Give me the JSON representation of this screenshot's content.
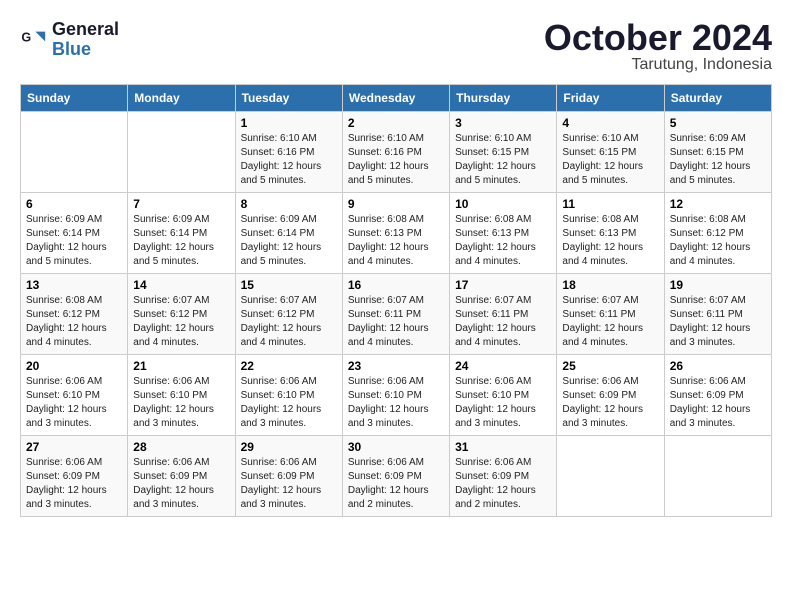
{
  "logo": {
    "line1": "General",
    "line2": "Blue"
  },
  "title": "October 2024",
  "location": "Tarutung, Indonesia",
  "days_of_week": [
    "Sunday",
    "Monday",
    "Tuesday",
    "Wednesday",
    "Thursday",
    "Friday",
    "Saturday"
  ],
  "weeks": [
    [
      {
        "num": "",
        "info": ""
      },
      {
        "num": "",
        "info": ""
      },
      {
        "num": "1",
        "info": "Sunrise: 6:10 AM\nSunset: 6:16 PM\nDaylight: 12 hours and 5 minutes."
      },
      {
        "num": "2",
        "info": "Sunrise: 6:10 AM\nSunset: 6:16 PM\nDaylight: 12 hours and 5 minutes."
      },
      {
        "num": "3",
        "info": "Sunrise: 6:10 AM\nSunset: 6:15 PM\nDaylight: 12 hours and 5 minutes."
      },
      {
        "num": "4",
        "info": "Sunrise: 6:10 AM\nSunset: 6:15 PM\nDaylight: 12 hours and 5 minutes."
      },
      {
        "num": "5",
        "info": "Sunrise: 6:09 AM\nSunset: 6:15 PM\nDaylight: 12 hours and 5 minutes."
      }
    ],
    [
      {
        "num": "6",
        "info": "Sunrise: 6:09 AM\nSunset: 6:14 PM\nDaylight: 12 hours and 5 minutes."
      },
      {
        "num": "7",
        "info": "Sunrise: 6:09 AM\nSunset: 6:14 PM\nDaylight: 12 hours and 5 minutes."
      },
      {
        "num": "8",
        "info": "Sunrise: 6:09 AM\nSunset: 6:14 PM\nDaylight: 12 hours and 5 minutes."
      },
      {
        "num": "9",
        "info": "Sunrise: 6:08 AM\nSunset: 6:13 PM\nDaylight: 12 hours and 4 minutes."
      },
      {
        "num": "10",
        "info": "Sunrise: 6:08 AM\nSunset: 6:13 PM\nDaylight: 12 hours and 4 minutes."
      },
      {
        "num": "11",
        "info": "Sunrise: 6:08 AM\nSunset: 6:13 PM\nDaylight: 12 hours and 4 minutes."
      },
      {
        "num": "12",
        "info": "Sunrise: 6:08 AM\nSunset: 6:12 PM\nDaylight: 12 hours and 4 minutes."
      }
    ],
    [
      {
        "num": "13",
        "info": "Sunrise: 6:08 AM\nSunset: 6:12 PM\nDaylight: 12 hours and 4 minutes."
      },
      {
        "num": "14",
        "info": "Sunrise: 6:07 AM\nSunset: 6:12 PM\nDaylight: 12 hours and 4 minutes."
      },
      {
        "num": "15",
        "info": "Sunrise: 6:07 AM\nSunset: 6:12 PM\nDaylight: 12 hours and 4 minutes."
      },
      {
        "num": "16",
        "info": "Sunrise: 6:07 AM\nSunset: 6:11 PM\nDaylight: 12 hours and 4 minutes."
      },
      {
        "num": "17",
        "info": "Sunrise: 6:07 AM\nSunset: 6:11 PM\nDaylight: 12 hours and 4 minutes."
      },
      {
        "num": "18",
        "info": "Sunrise: 6:07 AM\nSunset: 6:11 PM\nDaylight: 12 hours and 4 minutes."
      },
      {
        "num": "19",
        "info": "Sunrise: 6:07 AM\nSunset: 6:11 PM\nDaylight: 12 hours and 3 minutes."
      }
    ],
    [
      {
        "num": "20",
        "info": "Sunrise: 6:06 AM\nSunset: 6:10 PM\nDaylight: 12 hours and 3 minutes."
      },
      {
        "num": "21",
        "info": "Sunrise: 6:06 AM\nSunset: 6:10 PM\nDaylight: 12 hours and 3 minutes."
      },
      {
        "num": "22",
        "info": "Sunrise: 6:06 AM\nSunset: 6:10 PM\nDaylight: 12 hours and 3 minutes."
      },
      {
        "num": "23",
        "info": "Sunrise: 6:06 AM\nSunset: 6:10 PM\nDaylight: 12 hours and 3 minutes."
      },
      {
        "num": "24",
        "info": "Sunrise: 6:06 AM\nSunset: 6:10 PM\nDaylight: 12 hours and 3 minutes."
      },
      {
        "num": "25",
        "info": "Sunrise: 6:06 AM\nSunset: 6:09 PM\nDaylight: 12 hours and 3 minutes."
      },
      {
        "num": "26",
        "info": "Sunrise: 6:06 AM\nSunset: 6:09 PM\nDaylight: 12 hours and 3 minutes."
      }
    ],
    [
      {
        "num": "27",
        "info": "Sunrise: 6:06 AM\nSunset: 6:09 PM\nDaylight: 12 hours and 3 minutes."
      },
      {
        "num": "28",
        "info": "Sunrise: 6:06 AM\nSunset: 6:09 PM\nDaylight: 12 hours and 3 minutes."
      },
      {
        "num": "29",
        "info": "Sunrise: 6:06 AM\nSunset: 6:09 PM\nDaylight: 12 hours and 3 minutes."
      },
      {
        "num": "30",
        "info": "Sunrise: 6:06 AM\nSunset: 6:09 PM\nDaylight: 12 hours and 2 minutes."
      },
      {
        "num": "31",
        "info": "Sunrise: 6:06 AM\nSunset: 6:09 PM\nDaylight: 12 hours and 2 minutes."
      },
      {
        "num": "",
        "info": ""
      },
      {
        "num": "",
        "info": ""
      }
    ]
  ]
}
